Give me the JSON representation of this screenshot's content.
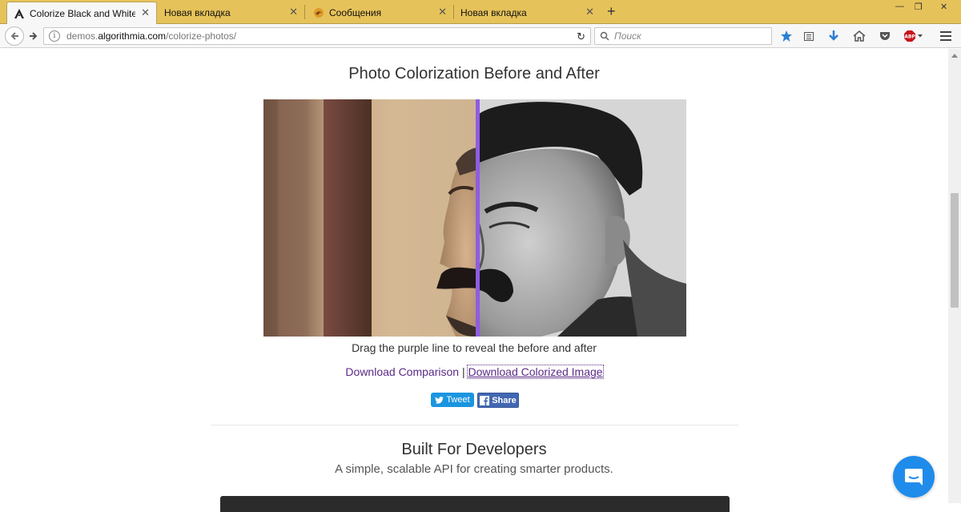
{
  "browser": {
    "tabs": [
      {
        "title": "Colorize Black and White ...",
        "active": true,
        "icon": "algorithmia-logo-icon"
      },
      {
        "title": "Новая вкладка",
        "active": false,
        "icon": ""
      },
      {
        "title": "Сообщения",
        "active": false,
        "icon": "messages-bird-icon"
      },
      {
        "title": "Новая вкладка",
        "active": false,
        "icon": ""
      }
    ],
    "url_host_prefix": "demos.",
    "url_host": "algorithmia.com",
    "url_path": "/colorize-photos/",
    "search_placeholder": "Поиск",
    "accent": "#e6c25a"
  },
  "page": {
    "heading": "Photo Colorization Before and After",
    "caption": "Drag the purple line to reveal the before and after",
    "download_comparison": "Download Comparison",
    "link_separator": "|",
    "download_colorized": "Download Colorized Image",
    "tweet_label": "Tweet",
    "share_label": "Share",
    "section_title": "Built For Developers",
    "section_subtitle": "A simple, scalable API for creating smarter products.",
    "divider_color": "#8e5de0",
    "link_color": "#5b2a86"
  }
}
